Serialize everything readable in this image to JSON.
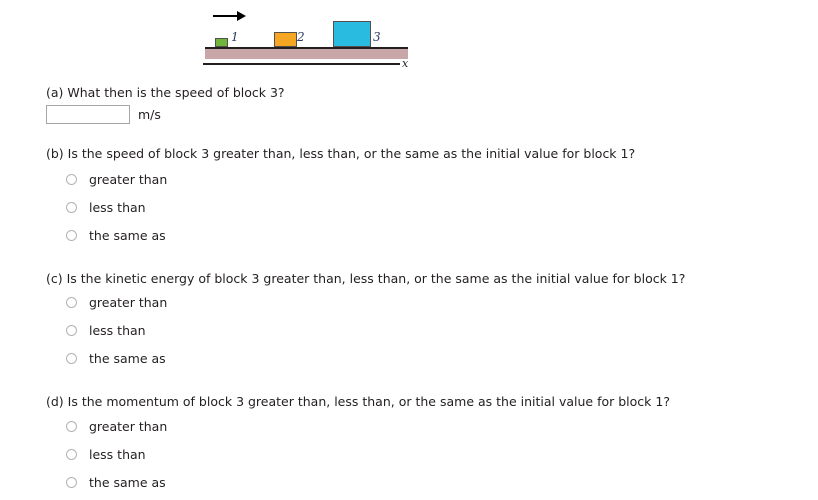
{
  "figure": {
    "arrow": "velocity-arrow-right",
    "axis_label": "x",
    "blocks": [
      {
        "number": "1",
        "color": "#6fb63c"
      },
      {
        "number": "2",
        "color": "#f5a623"
      },
      {
        "number": "3",
        "color": "#29bce0"
      }
    ],
    "ground_color": "#c9a6a8"
  },
  "questions": {
    "a": {
      "prompt": "(a) What then is the speed of block 3?",
      "value": "",
      "placeholder": "",
      "units": "m/s"
    },
    "b": {
      "prompt": "(b) Is the speed of block 3 greater than, less than, or the same as the initial value for block 1?",
      "options": [
        "greater than",
        "less than",
        "the same as"
      ]
    },
    "c": {
      "prompt": "(c) Is the kinetic energy of block 3 greater than, less than, or the same as the initial value for block 1?",
      "options": [
        "greater than",
        "less than",
        "the same as"
      ]
    },
    "d": {
      "prompt": "(d) Is the momentum of block 3 greater than, less than, or the same as the initial value for block 1?",
      "options": [
        "greater than",
        "less than",
        "the same as"
      ]
    }
  }
}
